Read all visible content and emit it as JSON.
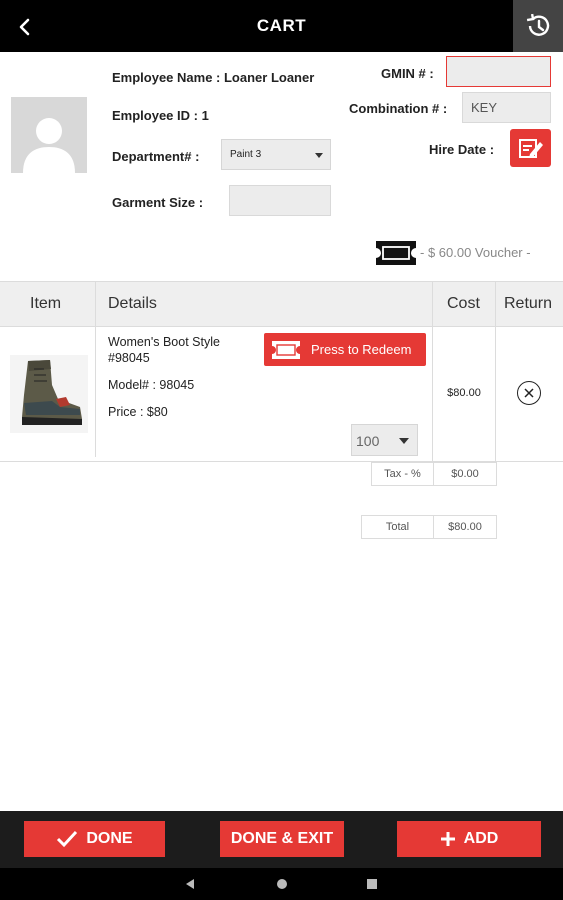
{
  "header": {
    "title": "CART"
  },
  "employee": {
    "name_label": "Employee Name : Loaner Loaner",
    "id_label": "Employee ID : 1",
    "department_label": "Department# :",
    "department_value": "Paint 3",
    "garment_size_label": "Garment Size :",
    "garment_size_value": "",
    "gmin_label": "GMIN # :",
    "gmin_value": "",
    "combination_label": "Combination # :",
    "combination_value": "KEY",
    "hire_date_label": "Hire Date :",
    "voucher_text": "- $ 60.00 Voucher -"
  },
  "table": {
    "headers": [
      "Item",
      "Details",
      "Cost",
      "Return"
    ],
    "rows": [
      {
        "title_line1": "Women's Boot Style",
        "title_line2": "#98045",
        "model": "Model# : 98045",
        "price": "Price : $80",
        "redeem_label": "Press to Redeem",
        "quantity": "100",
        "cost": "$80.00"
      }
    ]
  },
  "summary": {
    "tax_label": "Tax - %",
    "tax_value": "$0.00",
    "total_label": "Total",
    "total_value": "$80.00"
  },
  "actions": {
    "done_label": "DONE",
    "done_exit_label": "DONE & EXIT",
    "add_label": "ADD"
  },
  "colors": {
    "accent": "#e53935",
    "topbar": "#000000",
    "bottom_bar": "#1c1c1c"
  },
  "icons": {
    "back": "back-arrow-icon",
    "history": "history-icon",
    "hire_date": "edit-calendar-icon",
    "voucher": "voucher-ticket-icon",
    "return": "close-circle-icon",
    "done": "checkmark-icon",
    "add": "plus-icon"
  }
}
